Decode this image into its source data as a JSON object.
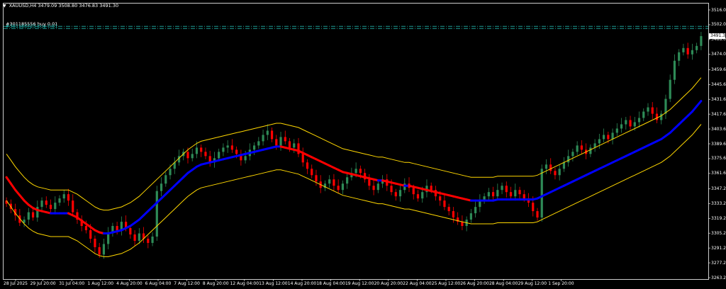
{
  "header": {
    "symbol": "XAUUSD,H4",
    "ohlc": "3479.09 3508.80 3476.83 3491.30"
  },
  "orders": [
    {
      "label": "#301185556 buy 0.01",
      "price": 3500.5
    },
    {
      "label": "#301188725 buy 0.01",
      "price": 3498.5
    }
  ],
  "current_price": "3491.30",
  "colors": {
    "background": "#000000",
    "grid": "#ffffff",
    "bull_candle": "#2e8b57",
    "bear_candle": "#ff0000",
    "band": "#ffd700",
    "ma_up": "#0000ff",
    "ma_down": "#ff0000",
    "order_line": "#20b2aa"
  },
  "axes": {
    "price_labels": [
      "3516.00",
      "3502.00",
      "3488.00",
      "3474.00",
      "3459.60",
      "3445.60",
      "3431.60",
      "3417.60",
      "3403.60",
      "3389.60",
      "3375.60",
      "3361.60",
      "3347.20",
      "3333.20",
      "3319.20",
      "3305.20",
      "3291.20",
      "3277.20",
      "3263.20"
    ],
    "time_labels": [
      "28 Jul 2025",
      "29 Jul 20:00",
      "31 Jul 04:00",
      "1 Aug 12:00",
      "4 Aug 20:00",
      "6 Aug 04:00",
      "7 Aug 12:00",
      "8 Aug 20:00",
      "12 Aug 04:00",
      "13 Aug 12:00",
      "14 Aug 20:00",
      "18 Aug 04:00",
      "19 Aug 12:00",
      "20 Aug 20:00",
      "22 Aug 04:00",
      "25 Aug 12:00",
      "26 Aug 20:00",
      "28 Aug 04:00",
      "29 Aug 12:00",
      "1 Sep 20:00"
    ]
  },
  "chart_data": {
    "type": "candlestick",
    "symbol": "XAUUSD",
    "timeframe": "H4",
    "ylim": [
      3263.2,
      3516.0
    ],
    "last": {
      "open": 3479.09,
      "high": 3508.8,
      "low": 3476.83,
      "close": 3491.3
    },
    "closes": [
      3333,
      3328,
      3322,
      3315,
      3318,
      3325,
      3320,
      3330,
      3336,
      3332,
      3328,
      3334,
      3338,
      3342,
      3336,
      3325,
      3318,
      3312,
      3308,
      3300,
      3292,
      3285,
      3295,
      3305,
      3312,
      3308,
      3316,
      3310,
      3304,
      3298,
      3305,
      3300,
      3296,
      3302,
      3345,
      3352,
      3360,
      3366,
      3372,
      3378,
      3382,
      3376,
      3380,
      3386,
      3382,
      3378,
      3372,
      3376,
      3382,
      3386,
      3388,
      3384,
      3380,
      3374,
      3378,
      3384,
      3388,
      3392,
      3398,
      3402,
      3394,
      3388,
      3396,
      3392,
      3386,
      3390,
      3380,
      3372,
      3366,
      3360,
      3354,
      3348,
      3352,
      3356,
      3350,
      3346,
      3352,
      3358,
      3362,
      3366,
      3362,
      3356,
      3350,
      3346,
      3352,
      3356,
      3350,
      3344,
      3340,
      3346,
      3352,
      3348,
      3342,
      3338,
      3344,
      3350,
      3346,
      3340,
      3336,
      3330,
      3326,
      3320,
      3316,
      3312,
      3318,
      3324,
      3330,
      3336,
      3340,
      3344,
      3340,
      3346,
      3350,
      3344,
      3340,
      3346,
      3342,
      3338,
      3334,
      3326,
      3320,
      3366,
      3370,
      3364,
      3360,
      3366,
      3372,
      3378,
      3382,
      3388,
      3384,
      3380,
      3386,
      3390,
      3394,
      3398,
      3394,
      3400,
      3404,
      3408,
      3412,
      3406,
      3410,
      3414,
      3420,
      3424,
      3418,
      3412,
      3418,
      3432,
      3450,
      3468,
      3476,
      3480,
      3474,
      3478,
      3482,
      3491.3
    ],
    "ma": [
      3358,
      3352,
      3346,
      3341,
      3336,
      3332,
      3329,
      3327,
      3326,
      3325,
      3324,
      3324,
      3324,
      3324,
      3324,
      3322,
      3320,
      3317,
      3314,
      3311,
      3308,
      3306,
      3305,
      3305,
      3306,
      3307,
      3308,
      3310,
      3312,
      3315,
      3318,
      3322,
      3326,
      3330,
      3334,
      3338,
      3342,
      3346,
      3350,
      3354,
      3358,
      3362,
      3365,
      3368,
      3370,
      3371,
      3372,
      3373,
      3374,
      3375,
      3376,
      3377,
      3378,
      3379,
      3380,
      3381,
      3382,
      3383,
      3384,
      3385,
      3386,
      3387,
      3387,
      3386,
      3385,
      3384,
      3383,
      3381,
      3379,
      3377,
      3375,
      3373,
      3371,
      3369,
      3367,
      3365,
      3363,
      3362,
      3361,
      3360,
      3359,
      3358,
      3357,
      3356,
      3355,
      3355,
      3354,
      3353,
      3352,
      3351,
      3350,
      3350,
      3349,
      3348,
      3347,
      3346,
      3345,
      3344,
      3343,
      3342,
      3341,
      3340,
      3339,
      3338,
      3337,
      3336,
      3336,
      3336,
      3336,
      3336,
      3336,
      3337,
      3337,
      3337,
      3337,
      3337,
      3337,
      3337,
      3337,
      3337,
      3338,
      3340,
      3342,
      3344,
      3346,
      3348,
      3350,
      3352,
      3354,
      3356,
      3358,
      3360,
      3362,
      3364,
      3366,
      3368,
      3370,
      3372,
      3374,
      3376,
      3378,
      3380,
      3382,
      3384,
      3386,
      3388,
      3390,
      3392,
      3394,
      3397,
      3400,
      3404,
      3408,
      3412,
      3416,
      3420,
      3425,
      3430
    ]
  }
}
